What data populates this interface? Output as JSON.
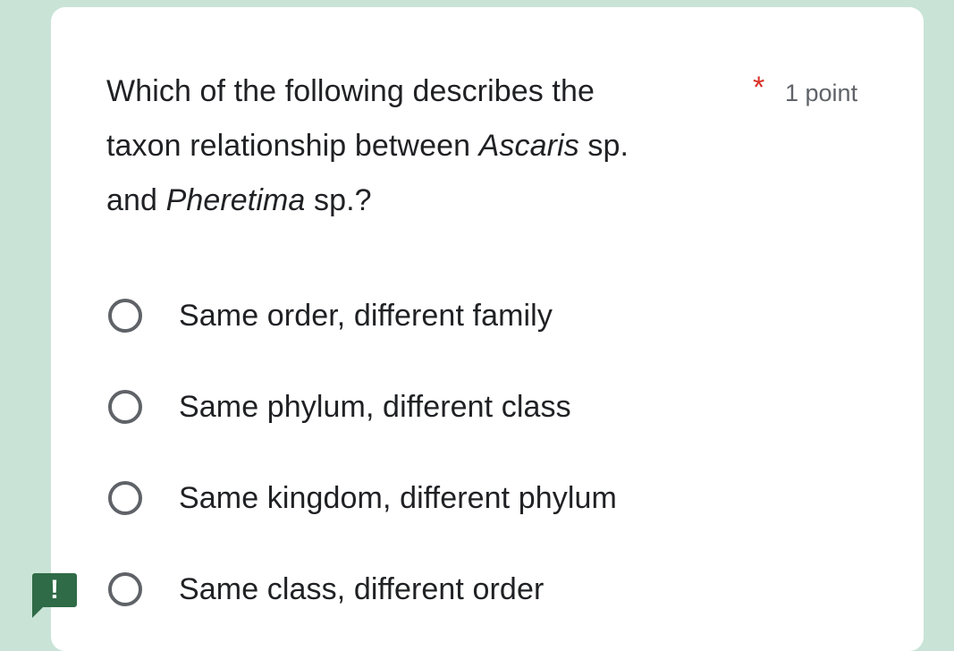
{
  "question": {
    "line1": "Which of the following describes the",
    "line2_prefix": "taxon relationship between ",
    "line2_italic": "Ascaris",
    "line2_suffix": " sp.",
    "line3_prefix": "and ",
    "line3_italic": "Pheretima",
    "line3_suffix": " sp.?",
    "required_marker": "*",
    "points": "1 point"
  },
  "options": [
    {
      "label": "Same order, different family",
      "selected": false
    },
    {
      "label": "Same phylum, different class",
      "selected": false
    },
    {
      "label": "Same kingdom, different phylum",
      "selected": false
    },
    {
      "label": "Same class, different order",
      "selected": false
    }
  ],
  "alert": {
    "icon": "exclamation-icon",
    "glyph": "!"
  },
  "colors": {
    "background": "#c9e4d7",
    "card": "#ffffff",
    "text": "#202124",
    "muted": "#5f6368",
    "required": "#d93025",
    "badge": "#2f6b46"
  }
}
